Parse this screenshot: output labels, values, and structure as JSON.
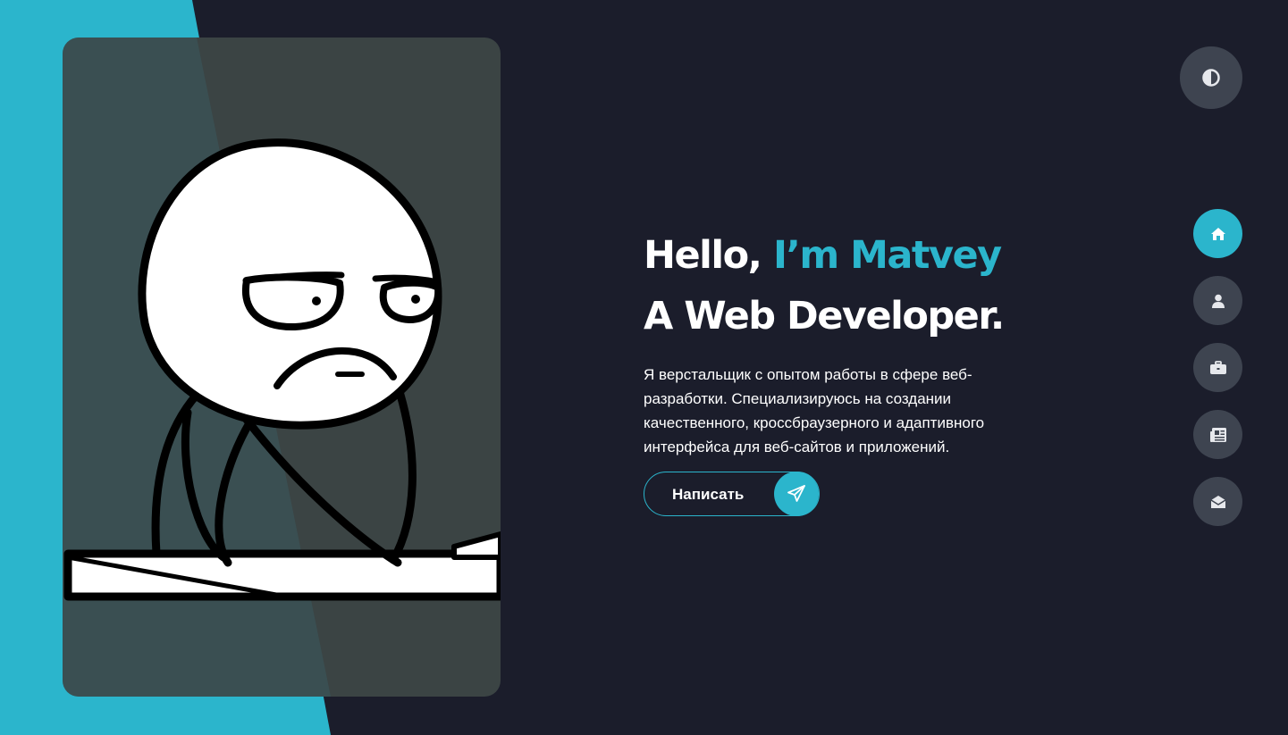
{
  "hero": {
    "greeting": "Hello, ",
    "name": "I’m Matvey",
    "title": "A Web Developer.",
    "description": "Я верстальщик с опытом работы в сфере веб-разработки. Специализируюсь на создании качественного, кроссбраузерного и адаптивного интерфейса для веб-сайтов и приложений."
  },
  "cta": {
    "label": "Написать",
    "icon": "send-icon"
  },
  "theme_toggle": {
    "icon": "contrast-icon"
  },
  "nav": {
    "items": [
      {
        "id": "home",
        "icon": "home-icon",
        "active": true
      },
      {
        "id": "about",
        "icon": "user-icon",
        "active": false
      },
      {
        "id": "portfolio",
        "icon": "briefcase-icon",
        "active": false
      },
      {
        "id": "blog",
        "icon": "newspaper-icon",
        "active": false
      },
      {
        "id": "contact",
        "icon": "envelope-icon",
        "active": false
      }
    ]
  },
  "colors": {
    "background": "#1b1d2b",
    "accent": "#2bb5cc",
    "button_bg": "#3e4450",
    "text": "#ffffff"
  }
}
